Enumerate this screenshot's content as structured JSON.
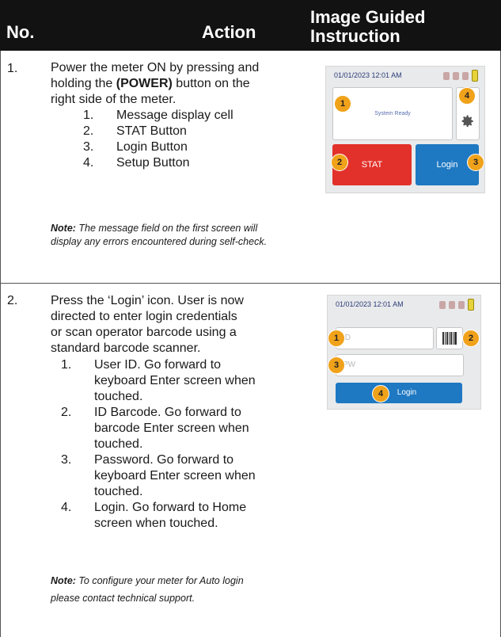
{
  "header": {
    "no": "No.",
    "action": "Action",
    "image_line1": "Image Guided",
    "image_line2": "Instruction"
  },
  "rows": [
    {
      "number": "1.",
      "text_lines": [
        "Power the meter ON by pressing and",
        "holding the ",
        "(POWER)",
        " button on the",
        "right side of the meter."
      ],
      "items": [
        {
          "n": "1.",
          "label": "Message display cell"
        },
        {
          "n": "2.",
          "label": "STAT Button"
        },
        {
          "n": "3.",
          "label": "Login Button"
        },
        {
          "n": "4.",
          "label": "Setup Button"
        }
      ],
      "note_label": "Note:",
      "note_text": " The message field on the first screen will display any errors encountered during self-check."
    },
    {
      "number": "2.",
      "text_lines": [
        "Press the ‘Login’ icon. User is now",
        "directed to enter login credentials",
        "or scan operator barcode using a",
        "standard barcode scanner."
      ],
      "items": [
        {
          "n": "1.",
          "label": "User ID. Go forward to keyboard Enter screen when touched."
        },
        {
          "n": "2.",
          "label": "ID Barcode. Go forward to barcode Enter screen when touched."
        },
        {
          "n": "3.",
          "label": "Password. Go forward to keyboard Enter screen when touched."
        },
        {
          "n": "4.",
          "label": "Login. Go forward to Home screen when touched."
        }
      ],
      "note_label": "Note:",
      "note_text": " To configure your meter for Auto login please contact technical support."
    }
  ],
  "screen1": {
    "datetime": "01/01/2023 12:01 AM",
    "message": "System Ready",
    "stat": "STAT",
    "login": "Login",
    "badges": [
      "1",
      "2",
      "3",
      "4"
    ]
  },
  "screen2": {
    "datetime": "01/01/2023 12:01 AM",
    "id_placeholder": "ID",
    "pw_placeholder": "PW",
    "login": "Login",
    "badges": [
      "1",
      "2",
      "3",
      "4"
    ]
  },
  "colors": {
    "header_bg": "#121212",
    "stat_red": "#e2312b",
    "login_blue": "#1e78c2",
    "badge_orange": "#f0a21a"
  },
  "icons": [
    "gear-icon",
    "barcode-icon",
    "mute-icon",
    "bluetooth-icon",
    "wifi-icon",
    "battery-icon"
  ]
}
